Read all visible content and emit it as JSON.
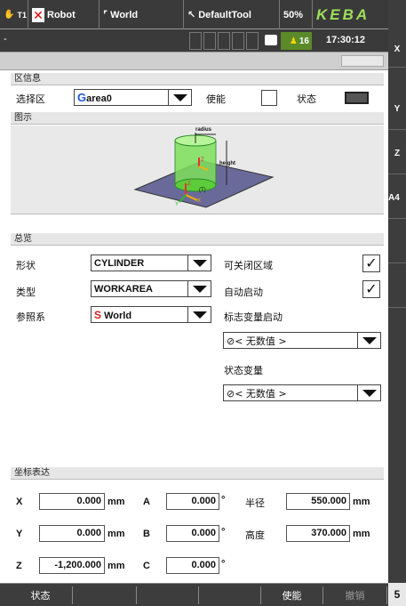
{
  "topbar": {
    "mode": "T1",
    "robot": "Robot",
    "world": "World",
    "tool": "DefaultTool",
    "override": "50%",
    "brand": "KEBA",
    "time": "17:30:12",
    "job_count": "16",
    "dash": "-"
  },
  "sidebar": {
    "buttons": [
      "X",
      "Y",
      "Z",
      "A4"
    ]
  },
  "zone_info": {
    "title": "区信息",
    "select_label": "选择区",
    "select_prefix": "G",
    "select_value": "area0",
    "enable_label": "使能",
    "status_label": "状态"
  },
  "diagram": {
    "title": "图示",
    "radius_label": "radius",
    "height_label": "height",
    "axis_z": "Z",
    "axis_x": "X",
    "axis_y": "Y",
    "frame_label": "(T)",
    "colors": {
      "cylinder": "#7ee05a",
      "plane": "#6a6a9a"
    }
  },
  "overview": {
    "title": "总览",
    "shape_label": "形状",
    "shape_value": "CYLINDER",
    "type_label": "类型",
    "type_value": "WORKAREA",
    "ref_label": "参照系",
    "ref_prefix": "S",
    "ref_value": "World",
    "closable_label": "可关闭区域",
    "autostart_label": "自动启动",
    "flag_label": "标志变量启动",
    "flag_value": "< 无数值 >",
    "state_var_label": "状态变量",
    "state_var_value": "< 无数值 >",
    "closable_checked": true,
    "autostart_checked": true
  },
  "coords": {
    "title": "坐标表达",
    "x_label": "X",
    "x_value": "0.000",
    "x_unit": "mm",
    "y_label": "Y",
    "y_value": "0.000",
    "y_unit": "mm",
    "z_label": "Z",
    "z_value": "-1,200.000",
    "z_unit": "mm",
    "a_label": "A",
    "a_value": "0.000",
    "a_unit": "°",
    "b_label": "B",
    "b_value": "0.000",
    "b_unit": "°",
    "c_label": "C",
    "c_value": "0.000",
    "c_unit": "°",
    "radius_label": "半径",
    "radius_value": "550.000",
    "radius_unit": "mm",
    "height_label": "高度",
    "height_value": "370.000",
    "height_unit": "mm"
  },
  "bottombar": {
    "status": "状态",
    "enable": "使能",
    "cancel": "撤销",
    "page": "5"
  }
}
